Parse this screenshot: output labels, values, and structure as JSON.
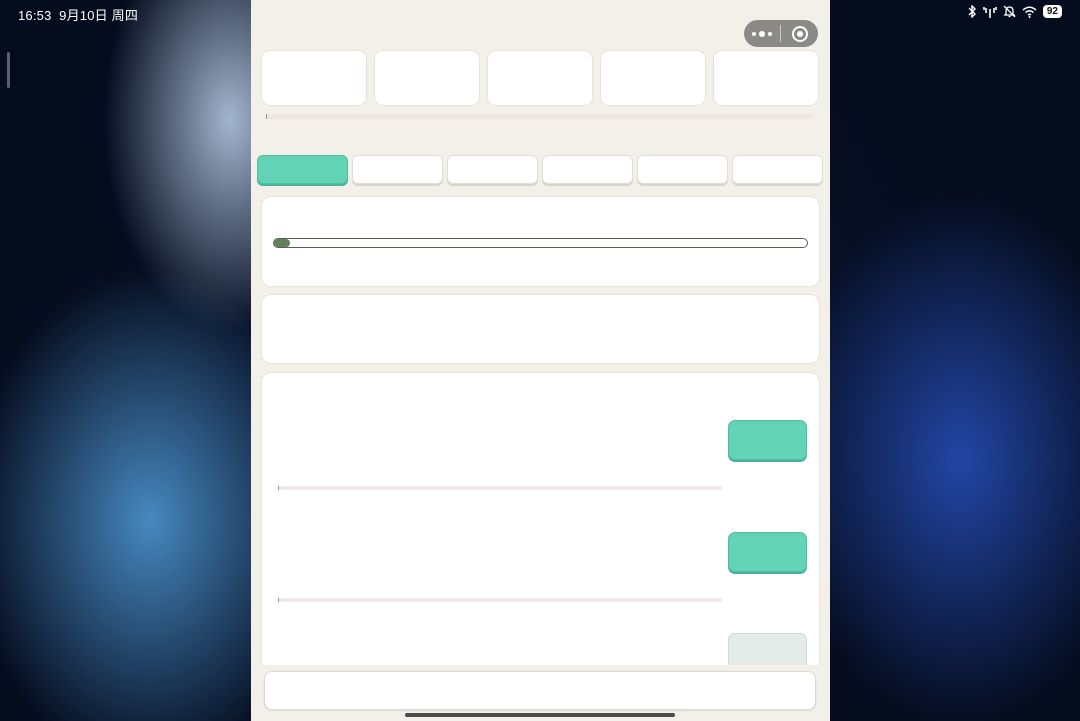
{
  "status_bar": {
    "time": "16:53",
    "date": "9月10日 周四",
    "battery": "92",
    "icons": [
      "bluetooth-icon",
      "signal-icon",
      "mute-icon",
      "wifi-icon",
      "battery-icon"
    ]
  },
  "capsule": {
    "more_icon": "more-dots-icon",
    "close_icon": "close-target-icon",
    "color": "#8c8a87"
  },
  "stats": [
    "",
    "",
    "",
    "",
    ""
  ],
  "tabs": [
    {
      "label": "",
      "active": true
    },
    {
      "label": "",
      "active": false
    },
    {
      "label": "",
      "active": false
    },
    {
      "label": "",
      "active": false
    },
    {
      "label": "",
      "active": false
    },
    {
      "label": "",
      "active": false
    }
  ],
  "progress": {
    "value": 0.03
  },
  "list": {
    "items": [
      {
        "button_label": "",
        "enabled": true
      },
      {
        "button_label": "",
        "enabled": true
      },
      {
        "button_label": "",
        "enabled": false
      }
    ]
  },
  "colors": {
    "accent": "#63d3b6",
    "progress_fill": "#63805d",
    "app_background": "#f3f0ea"
  }
}
